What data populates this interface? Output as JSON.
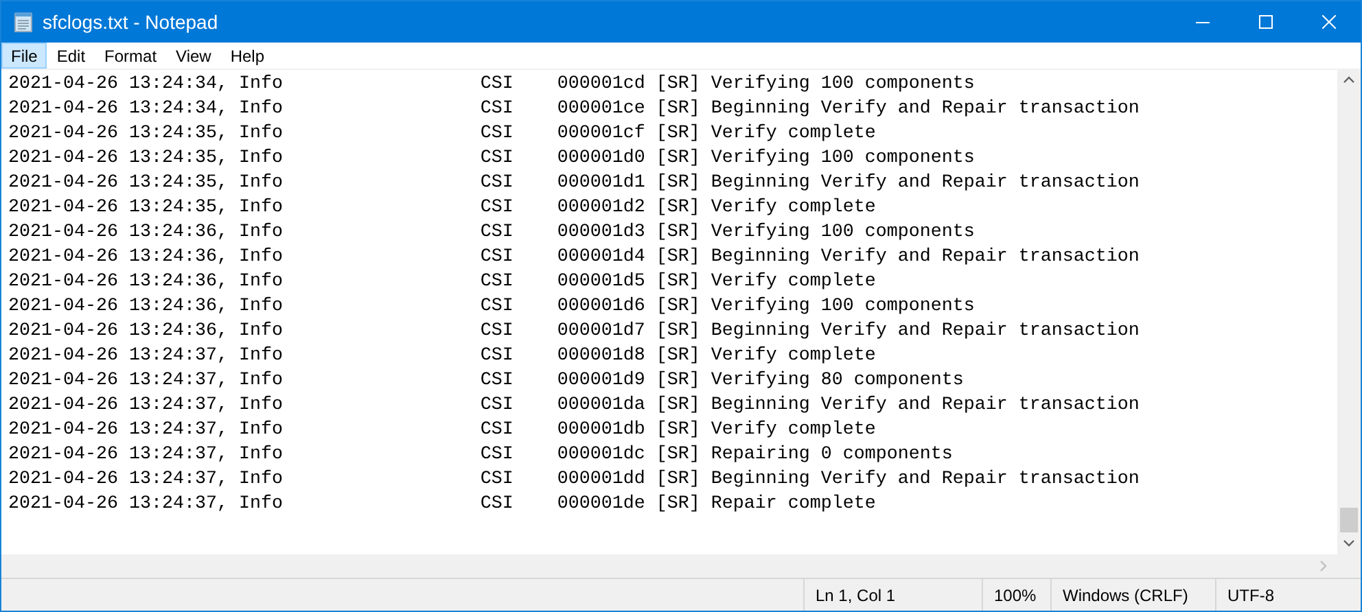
{
  "window": {
    "title": "sfclogs.txt - Notepad"
  },
  "menu": [
    {
      "label": "File",
      "selected": true
    },
    {
      "label": "Edit",
      "selected": false
    },
    {
      "label": "Format",
      "selected": false
    },
    {
      "label": "View",
      "selected": false
    },
    {
      "label": "Help",
      "selected": false
    }
  ],
  "lines": [
    "2021-04-26 13:24:34, Info                  CSI    000001cd [SR] Verifying 100 components",
    "2021-04-26 13:24:34, Info                  CSI    000001ce [SR] Beginning Verify and Repair transaction",
    "2021-04-26 13:24:35, Info                  CSI    000001cf [SR] Verify complete",
    "2021-04-26 13:24:35, Info                  CSI    000001d0 [SR] Verifying 100 components",
    "2021-04-26 13:24:35, Info                  CSI    000001d1 [SR] Beginning Verify and Repair transaction",
    "2021-04-26 13:24:35, Info                  CSI    000001d2 [SR] Verify complete",
    "2021-04-26 13:24:36, Info                  CSI    000001d3 [SR] Verifying 100 components",
    "2021-04-26 13:24:36, Info                  CSI    000001d4 [SR] Beginning Verify and Repair transaction",
    "2021-04-26 13:24:36, Info                  CSI    000001d5 [SR] Verify complete",
    "2021-04-26 13:24:36, Info                  CSI    000001d6 [SR] Verifying 100 components",
    "2021-04-26 13:24:36, Info                  CSI    000001d7 [SR] Beginning Verify and Repair transaction",
    "2021-04-26 13:24:37, Info                  CSI    000001d8 [SR] Verify complete",
    "2021-04-26 13:24:37, Info                  CSI    000001d9 [SR] Verifying 80 components",
    "2021-04-26 13:24:37, Info                  CSI    000001da [SR] Beginning Verify and Repair transaction",
    "2021-04-26 13:24:37, Info                  CSI    000001db [SR] Verify complete",
    "2021-04-26 13:24:37, Info                  CSI    000001dc [SR] Repairing 0 components",
    "2021-04-26 13:24:37, Info                  CSI    000001dd [SR] Beginning Verify and Repair transaction",
    "2021-04-26 13:24:37, Info                  CSI    000001de [SR] Repair complete"
  ],
  "status_bar": [
    "Ln 1, Col 1",
    "100%",
    "Windows (CRLF)",
    "UTF-8"
  ]
}
